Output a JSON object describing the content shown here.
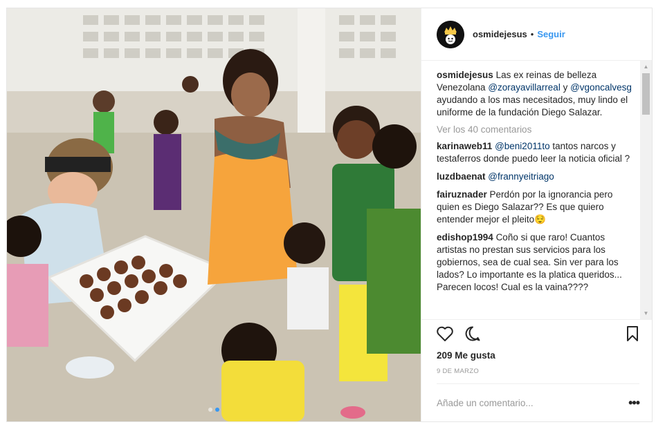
{
  "post": {
    "username": "osmidejesus",
    "bullet": "•",
    "follow_label": "Seguir",
    "caption": {
      "author": "osmidejesus",
      "segments": [
        {
          "text": "Las ex reinas de belleza Venezolana ",
          "mention": false
        },
        {
          "text": "@zorayavillarreal",
          "mention": true
        },
        {
          "text": " y ",
          "mention": false
        },
        {
          "text": "@vgoncalvesg",
          "mention": true
        },
        {
          "text": " ayudando a los mas necesitados, muy lindo el uniforme de la fundación Diego Salazar.",
          "mention": false
        }
      ]
    },
    "view_all_label": "Ver los 40 comentarios",
    "comments": [
      {
        "author": "karinaweb11",
        "segments": [
          {
            "text": "@beni2011to",
            "mention": true
          },
          {
            "text": " tantos narcos y testaferros donde puedo leer la noticia oficial ?",
            "mention": false
          }
        ]
      },
      {
        "author": "luzdbaenat",
        "segments": [
          {
            "text": "@frannyeitriago",
            "mention": true
          }
        ]
      },
      {
        "author": "fairuznader",
        "segments": [
          {
            "text": "Perdón por la ignorancia pero quien es Diego Salazar?? Es que quiero entender mejor el pleito😌",
            "mention": false
          }
        ]
      },
      {
        "author": "edishop1994",
        "segments": [
          {
            "text": "Coño si que raro! Cuantos artistas no prestan sus servicios para los gobiernos, sea de cual sea. Sin ver para los lados? Lo importante es la platica queridos... Parecen locos! Cual es la vaina????",
            "mention": false
          }
        ]
      }
    ],
    "likes": "209 Me gusta",
    "date": "9 DE MARZO",
    "add_comment_placeholder": "Añade un comentario...",
    "more_label": "•••",
    "icons": {
      "like": "heart-icon",
      "comment": "comment-bubble-icon",
      "save": "bookmark-icon",
      "avatar": "crown-logo-avatar"
    },
    "colors": {
      "accent": "#3897f0",
      "mention": "#003569",
      "muted": "#999999",
      "text": "#262626",
      "border": "#efefef"
    },
    "carousel": {
      "total": 2,
      "active": 2
    }
  }
}
